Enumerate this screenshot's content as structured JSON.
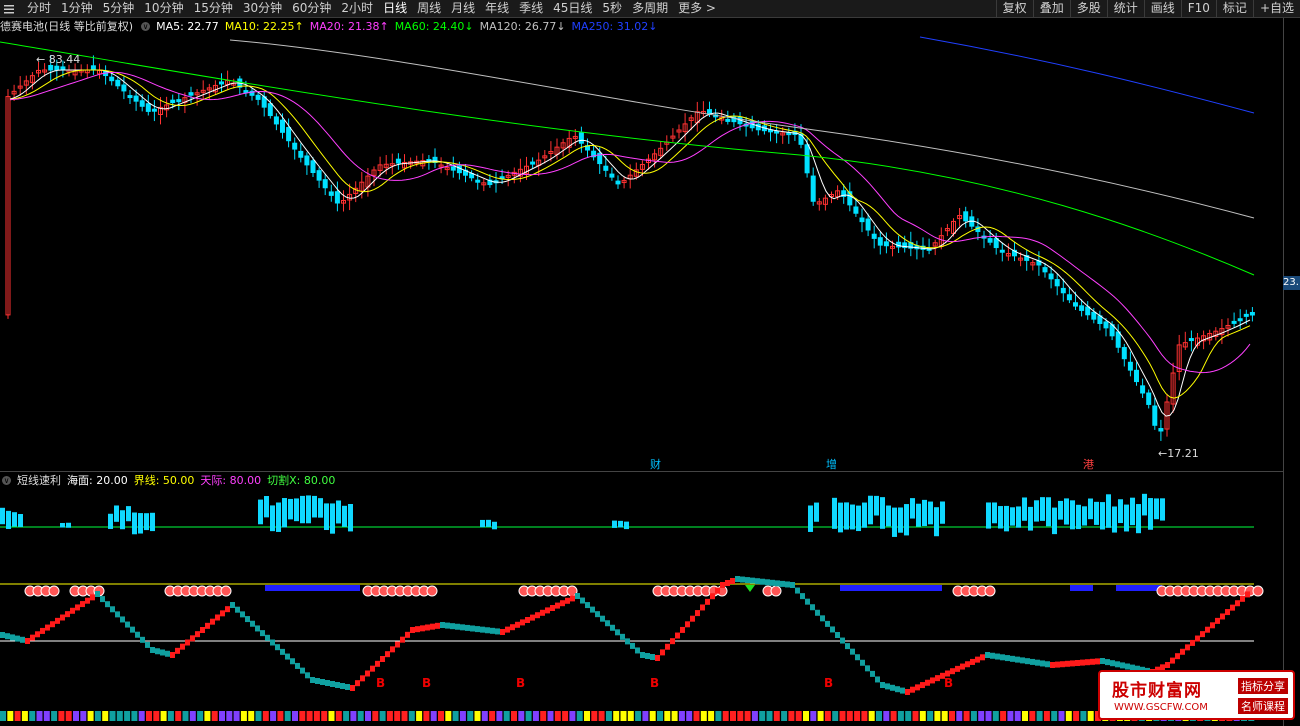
{
  "topbar": {
    "tabs": [
      "分时",
      "1分钟",
      "5分钟",
      "10分钟",
      "15分钟",
      "30分钟",
      "60分钟",
      "2小时",
      "日线",
      "周线",
      "月线",
      "年线",
      "季线",
      "45日线",
      "5秒",
      "多周期",
      "更多 >"
    ],
    "active_tab": "日线",
    "right_tools": [
      "复权",
      "叠加",
      "多股",
      "统计",
      "画线",
      "F10",
      "标记",
      "+自选"
    ]
  },
  "ma_legend": {
    "title": "德赛电池(日线 等比前复权)",
    "items": [
      {
        "label": "MA5: 22.77",
        "color": "#ffffff"
      },
      {
        "label": "MA10: 22.25↑",
        "color": "#ffff00"
      },
      {
        "label": "MA20: 21.38↑",
        "color": "#ff40ff"
      },
      {
        "label": "MA60: 24.40↓",
        "color": "#00ff00"
      },
      {
        "label": "MA120: 26.77↓",
        "color": "#c0c0c0"
      },
      {
        "label": "MA250: 31.02↓",
        "color": "#2040ff"
      }
    ]
  },
  "price_marks": {
    "high": "83.44",
    "low": "17.21",
    "last_price_tag": "23."
  },
  "events": [
    {
      "label": "财",
      "color": "#00c0ff"
    },
    {
      "label": "增",
      "color": "#00c0ff"
    },
    {
      "label": "港",
      "color": "#ff4040"
    }
  ],
  "indicator_legend": {
    "title": "短线速利",
    "items": [
      {
        "label": "海面: 20.00",
        "color": "#ffffff"
      },
      {
        "label": "界线: 50.00",
        "color": "#ffff00"
      },
      {
        "label": "天际: 80.00",
        "color": "#ff40ff"
      },
      {
        "label": "切割X: 80.00",
        "color": "#40ff40"
      }
    ]
  },
  "b_signals": [
    "B",
    "B",
    "B",
    "B",
    "B",
    "B"
  ],
  "watermark": {
    "title": "股市财富网",
    "url": "WWW.GSCFW.COM",
    "tag1": "指标分享",
    "tag2": "名师课程"
  },
  "colors": {
    "up": "#ff3232",
    "down": "#00e0ff",
    "ma5": "#ffffff",
    "ma10": "#ffff00",
    "ma20": "#ff40ff",
    "ma60": "#00ff00",
    "ma120": "#c0c0c0",
    "ma250": "#2040ff"
  }
}
